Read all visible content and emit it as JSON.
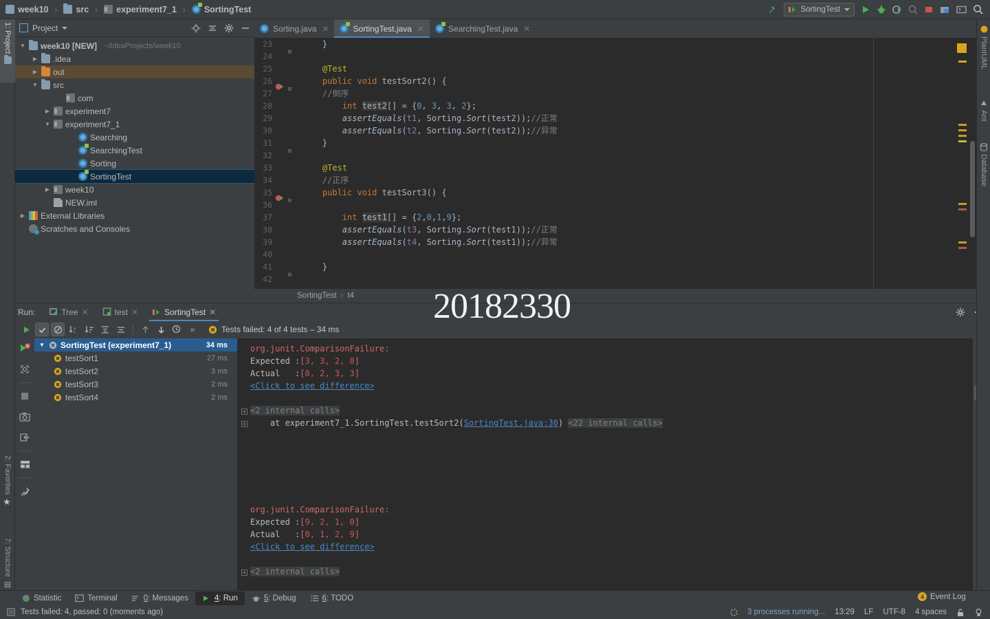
{
  "navbar": {
    "breadcrumb": [
      "week10",
      "src",
      "experiment7_1",
      "SortingTest"
    ],
    "run_config": "SortingTest",
    "icons": [
      "hammer-icon",
      "run-icon",
      "debug-icon",
      "run-coverage-icon",
      "profile-icon",
      "stop-icon",
      "open-folder-icon",
      "terminal-icon",
      "search-everywhere-icon"
    ]
  },
  "left_strip": {
    "project": "1: Project",
    "favorites": "2: Favorites",
    "structure": "7: Structure"
  },
  "right_strip": {
    "plantuml": "PlantUML",
    "ant": "Ant",
    "database": "Database"
  },
  "project_panel": {
    "title": "Project",
    "tree": [
      {
        "label": "week10 [NEW]",
        "suffix": "~/IdeaProjects/week10",
        "indent": 0,
        "arrow": "down",
        "icon": "project-icon",
        "bold": true
      },
      {
        "label": ".idea",
        "indent": 1,
        "arrow": "right",
        "icon": "folder-icon"
      },
      {
        "label": "out",
        "indent": 1,
        "arrow": "right",
        "icon": "folder-out-icon",
        "highlight": true
      },
      {
        "label": "src",
        "indent": 1,
        "arrow": "down",
        "icon": "folder-src-icon"
      },
      {
        "label": "com",
        "indent": 3,
        "arrow": "none",
        "icon": "package-icon"
      },
      {
        "label": "experiment7",
        "indent": 2,
        "arrow": "right",
        "icon": "package-icon"
      },
      {
        "label": "experiment7_1",
        "indent": 2,
        "arrow": "down",
        "icon": "package-icon"
      },
      {
        "label": "Searching",
        "indent": 4,
        "arrow": "none",
        "icon": "class-icon"
      },
      {
        "label": "SearchingTest",
        "indent": 4,
        "arrow": "none",
        "icon": "test-class-icon"
      },
      {
        "label": "Sorting",
        "indent": 4,
        "arrow": "none",
        "icon": "class-icon"
      },
      {
        "label": "SortingTest",
        "indent": 4,
        "arrow": "none",
        "icon": "test-class-icon",
        "selected": true
      },
      {
        "label": "week10",
        "indent": 2,
        "arrow": "right",
        "icon": "package-icon"
      },
      {
        "label": "NEW.iml",
        "indent": 2,
        "arrow": "none",
        "icon": "iml-icon"
      },
      {
        "label": "External Libraries",
        "indent": 0,
        "arrow": "right",
        "icon": "libraries-icon"
      },
      {
        "label": "Scratches and Consoles",
        "indent": 0,
        "arrow": "none",
        "icon": "scratches-icon"
      }
    ]
  },
  "editor": {
    "tabs": [
      {
        "label": "Sorting.java",
        "icon": "class-icon",
        "active": false
      },
      {
        "label": "SortingTest.java",
        "icon": "test-class-icon",
        "active": true
      },
      {
        "label": "SearchingTest.java",
        "icon": "test-class-icon",
        "active": false
      }
    ],
    "breadcrumb": [
      "SortingTest",
      "t4"
    ],
    "first_line": 23,
    "lines": [
      {
        "n": 23,
        "fold": true,
        "tokens": [
          {
            "t": "    }",
            "c": ""
          }
        ]
      },
      {
        "n": 24,
        "tokens": []
      },
      {
        "n": 25,
        "tokens": [
          {
            "t": "    ",
            "c": ""
          },
          {
            "t": "@Test",
            "c": "ann"
          }
        ]
      },
      {
        "n": 26,
        "gutter": "run-test-icon",
        "fold": true,
        "tokens": [
          {
            "t": "    ",
            "c": ""
          },
          {
            "t": "public void ",
            "c": "kw"
          },
          {
            "t": "testSort2",
            "c": ""
          },
          {
            "t": "() {",
            "c": ""
          }
        ]
      },
      {
        "n": 27,
        "tokens": [
          {
            "t": "    //倒序",
            "c": "cmt"
          }
        ]
      },
      {
        "n": 28,
        "tokens": [
          {
            "t": "        ",
            "c": ""
          },
          {
            "t": "int ",
            "c": "kw"
          },
          {
            "t": "test2",
            "c": "hlv"
          },
          {
            "t": "[] = {",
            "c": ""
          },
          {
            "t": "0",
            "c": "num"
          },
          {
            "t": ", ",
            "c": ""
          },
          {
            "t": "3",
            "c": "num"
          },
          {
            "t": ", ",
            "c": ""
          },
          {
            "t": "3",
            "c": "num"
          },
          {
            "t": ", ",
            "c": ""
          },
          {
            "t": "2",
            "c": "num"
          },
          {
            "t": "};",
            "c": ""
          }
        ]
      },
      {
        "n": 29,
        "tokens": [
          {
            "t": "        ",
            "c": ""
          },
          {
            "t": "assertEquals",
            "c": "stat"
          },
          {
            "t": "(",
            "c": ""
          },
          {
            "t": "t1",
            "c": "fld"
          },
          {
            "t": ", Sorting.",
            "c": ""
          },
          {
            "t": "Sort",
            "c": "stat"
          },
          {
            "t": "(test2));",
            "c": ""
          },
          {
            "t": "//正常",
            "c": "cmt"
          }
        ]
      },
      {
        "n": 30,
        "tokens": [
          {
            "t": "        ",
            "c": ""
          },
          {
            "t": "assertEquals",
            "c": "stat"
          },
          {
            "t": "(",
            "c": ""
          },
          {
            "t": "t2",
            "c": "fld"
          },
          {
            "t": ", Sorting.",
            "c": ""
          },
          {
            "t": "Sort",
            "c": "stat"
          },
          {
            "t": "(test2));",
            "c": ""
          },
          {
            "t": "//异常",
            "c": "cmt"
          }
        ]
      },
      {
        "n": 31,
        "fold": true,
        "tokens": [
          {
            "t": "    }",
            "c": ""
          }
        ]
      },
      {
        "n": 32,
        "tokens": []
      },
      {
        "n": 33,
        "tokens": [
          {
            "t": "    ",
            "c": ""
          },
          {
            "t": "@Test",
            "c": "ann"
          }
        ]
      },
      {
        "n": 34,
        "tokens": [
          {
            "t": "    //正序",
            "c": "cmt"
          }
        ]
      },
      {
        "n": 35,
        "gutter": "run-test-icon",
        "fold": true,
        "tokens": [
          {
            "t": "    ",
            "c": ""
          },
          {
            "t": "public void ",
            "c": "kw"
          },
          {
            "t": "testSort3",
            "c": ""
          },
          {
            "t": "() {",
            "c": ""
          }
        ]
      },
      {
        "n": 36,
        "tokens": []
      },
      {
        "n": 37,
        "tokens": [
          {
            "t": "        ",
            "c": ""
          },
          {
            "t": "int ",
            "c": "kw"
          },
          {
            "t": "test1",
            "c": "hlv"
          },
          {
            "t": "[] = {",
            "c": ""
          },
          {
            "t": "2",
            "c": "num"
          },
          {
            "t": ",",
            "c": ""
          },
          {
            "t": "0",
            "c": "num"
          },
          {
            "t": ",",
            "c": ""
          },
          {
            "t": "1",
            "c": "num"
          },
          {
            "t": ",",
            "c": ""
          },
          {
            "t": "9",
            "c": "num"
          },
          {
            "t": "};",
            "c": ""
          }
        ]
      },
      {
        "n": 38,
        "tokens": [
          {
            "t": "        ",
            "c": ""
          },
          {
            "t": "assertEquals",
            "c": "stat"
          },
          {
            "t": "(",
            "c": ""
          },
          {
            "t": "t3",
            "c": "fld"
          },
          {
            "t": ", Sorting.",
            "c": ""
          },
          {
            "t": "Sort",
            "c": "stat"
          },
          {
            "t": "(test1));",
            "c": ""
          },
          {
            "t": "//正常",
            "c": "cmt"
          }
        ]
      },
      {
        "n": 39,
        "tokens": [
          {
            "t": "        ",
            "c": ""
          },
          {
            "t": "assertEquals",
            "c": "stat"
          },
          {
            "t": "(",
            "c": ""
          },
          {
            "t": "t4",
            "c": "fld"
          },
          {
            "t": ", Sorting.",
            "c": ""
          },
          {
            "t": "Sort",
            "c": "stat"
          },
          {
            "t": "(test1));",
            "c": ""
          },
          {
            "t": "//异常",
            "c": "cmt"
          }
        ]
      },
      {
        "n": 40,
        "tokens": []
      },
      {
        "n": 41,
        "fold": true,
        "tokens": [
          {
            "t": "    }",
            "c": ""
          }
        ]
      },
      {
        "n": 42,
        "tokens": []
      }
    ]
  },
  "watermark": "20182330",
  "run_panel": {
    "label": "Run:",
    "tabs": [
      {
        "label": "Tree",
        "icon": "tree-icon",
        "active": false
      },
      {
        "label": "test",
        "icon": "test-icon",
        "active": false
      },
      {
        "label": "SortingTest",
        "icon": "run-config-icon",
        "active": true
      }
    ],
    "toolbar": [
      "show-passed-icon",
      "show-ignored-icon",
      "sort-alphabetically-icon",
      "sort-duration-icon",
      "expand-all-icon",
      "collapse-all-icon",
      "prev-failed-icon",
      "next-failed-icon",
      "history-icon",
      "more-icon"
    ],
    "status": "Tests failed: 4 of 4 tests – 34 ms",
    "status_prefix": "Tests failed",
    "tests": [
      {
        "name": "SortingTest (experiment7_1)",
        "time": "34 ms",
        "status": "failed",
        "root": true,
        "selected": true
      },
      {
        "name": "testSort1",
        "time": "27 ms",
        "status": "failed"
      },
      {
        "name": "testSort2",
        "time": "3 ms",
        "status": "failed"
      },
      {
        "name": "testSort3",
        "time": "2 ms",
        "status": "failed"
      },
      {
        "name": "testSort4",
        "time": "2 ms",
        "status": "failed"
      }
    ],
    "console": [
      {
        "segs": [
          {
            "t": "org.junit.ComparisonFailure:",
            "c": "err"
          }
        ]
      },
      {
        "segs": [
          {
            "t": "Expected :",
            "c": ""
          },
          {
            "t": "[",
            "c": "err"
          },
          {
            "t": "3, 3, 2, 0",
            "c": "errb"
          },
          {
            "t": "]",
            "c": "err"
          }
        ]
      },
      {
        "segs": [
          {
            "t": "Actual   :",
            "c": ""
          },
          {
            "t": "[",
            "c": "err"
          },
          {
            "t": "0, 2, 3, 3",
            "c": "errb"
          },
          {
            "t": "]",
            "c": "err"
          }
        ]
      },
      {
        "segs": [
          {
            "t": "<Click to see difference>",
            "c": "lnk"
          }
        ]
      },
      {
        "segs": []
      },
      {
        "segs": [
          {
            "t": "<2 internal calls>",
            "c": "gray"
          }
        ],
        "expand": true
      },
      {
        "segs": [
          {
            "t": "    at experiment7_1.SortingTest.testSort2(",
            "c": ""
          },
          {
            "t": "SortingTest.java:30",
            "c": "lnk"
          },
          {
            "t": ") ",
            "c": ""
          },
          {
            "t": "<22 internal calls>",
            "c": "gray"
          }
        ],
        "expand": true
      },
      {
        "segs": []
      },
      {
        "segs": []
      },
      {
        "segs": []
      },
      {
        "segs": []
      },
      {
        "segs": []
      },
      {
        "segs": []
      },
      {
        "segs": [
          {
            "t": "org.junit.ComparisonFailure:",
            "c": "err"
          }
        ]
      },
      {
        "segs": [
          {
            "t": "Expected :",
            "c": ""
          },
          {
            "t": "[",
            "c": "err"
          },
          {
            "t": "9, 2, 1, 0",
            "c": "errb"
          },
          {
            "t": "]",
            "c": "err"
          }
        ]
      },
      {
        "segs": [
          {
            "t": "Actual   :",
            "c": ""
          },
          {
            "t": "[",
            "c": "err"
          },
          {
            "t": "0, 1, 2, 9",
            "c": "errb"
          },
          {
            "t": "]",
            "c": "err"
          }
        ]
      },
      {
        "segs": [
          {
            "t": "<Click to see difference>",
            "c": "lnk"
          }
        ]
      },
      {
        "segs": []
      },
      {
        "segs": [
          {
            "t": "<2 internal calls>",
            "c": "gray"
          }
        ],
        "expand": true
      }
    ],
    "console_icons": [
      "scroll-up-icon",
      "scroll-down-icon",
      "soft-wrap-icon",
      "scroll-to-end-icon",
      "print-icon",
      "clear-all-icon"
    ],
    "gutter_icons": [
      "rerun-icon",
      "rerun-failed-icon",
      "stop-icon",
      "screenshot-icon",
      "export-icon",
      "dashboard-icon",
      "pin-icon"
    ]
  },
  "bottom_tabs": [
    {
      "label": "Statistic",
      "icon": "statistic-icon",
      "key": "",
      "active": false
    },
    {
      "label": "Terminal",
      "icon": "terminal-icon",
      "key": "",
      "active": false
    },
    {
      "label": "Messages",
      "icon": "messages-icon",
      "key": "0",
      "active": false
    },
    {
      "label": "Run",
      "icon": "run-icon",
      "key": "4",
      "active": true
    },
    {
      "label": "Debug",
      "icon": "debug-icon",
      "key": "5",
      "active": false
    },
    {
      "label": "TODO",
      "icon": "todo-icon",
      "key": "6",
      "active": false
    }
  ],
  "event_log": {
    "label": "Event Log",
    "count": "4"
  },
  "statusbar": {
    "message": "Tests failed: 4, passed: 0 (moments ago)",
    "processes": "3 processes running...",
    "time": "13:29",
    "line_sep": "LF",
    "encoding": "UTF-8",
    "indent": "4 spaces",
    "lock_icon": "lock-icon",
    "inspection_icon": "inspection-icon"
  },
  "colors": {
    "accent_blue": "#4a88c7",
    "selection": "#2a5d8f",
    "error_red": "#cf6a6a",
    "panel_bg": "#3c3f41",
    "editor_bg": "#2b2b2b",
    "warning_orange": "#d9a520"
  }
}
